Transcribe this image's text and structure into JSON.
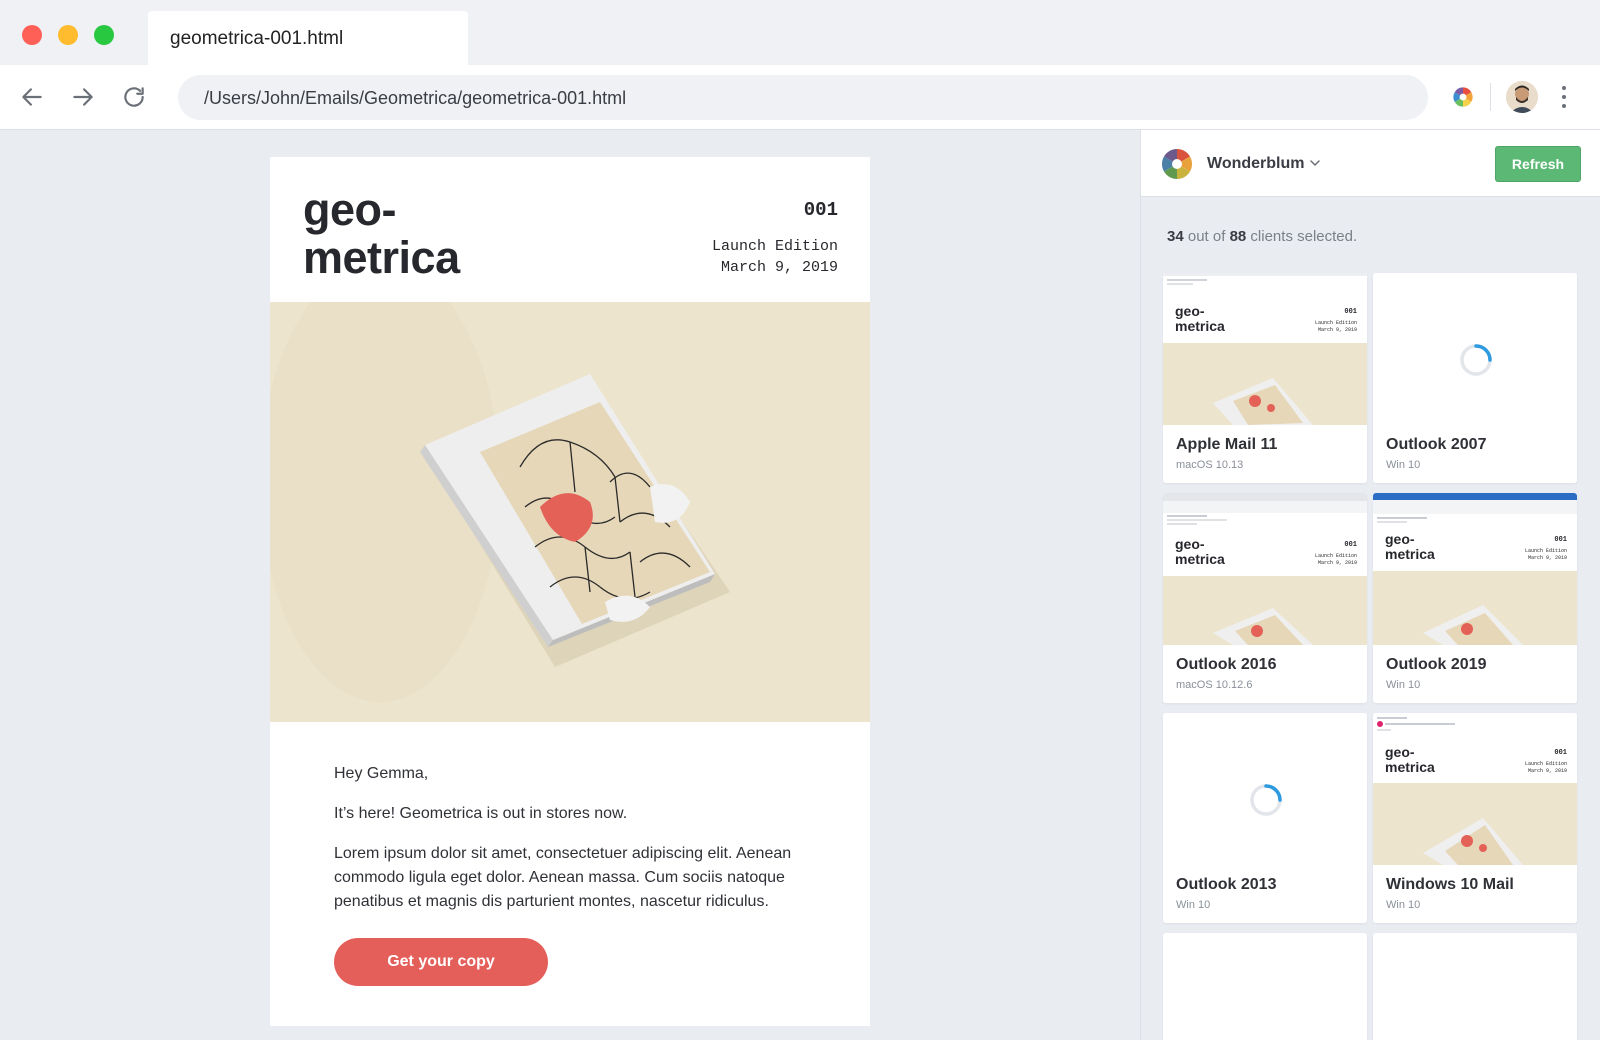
{
  "browser": {
    "tab_title": "geometrica-001.html",
    "address": "/Users/John/Emails/Geometrica/geometrica-001.html",
    "icons": [
      "back-arrow-icon",
      "forward-arrow-icon",
      "reload-icon",
      "extension-icon",
      "avatar",
      "more-vert-icon"
    ]
  },
  "email": {
    "brand_line1": "geo-",
    "brand_line2": "metrica",
    "issue": "001",
    "edition": "Launch Edition",
    "date": "March 9, 2019",
    "greeting": "Hey Gemma,",
    "intro": "It’s here! Geometrica is out in stores now.",
    "body": "Lorem ipsum dolor sit amet, consectetuer adipiscing elit. Aenean commodo ligula eget dolor. Aenean massa. Cum sociis natoque penatibus et magnis dis parturient montes, nascetur ridiculus.",
    "cta": "Get your copy",
    "colors": {
      "accent": "#e45f59",
      "hero_bg": "#ede4cd"
    }
  },
  "panel": {
    "workspace": "Wonderblum",
    "refresh": "Refresh",
    "selected_count": "34",
    "total_count": "88",
    "selected_text_mid": "out of",
    "selected_text_end": "clients selected.",
    "refresh_color": "#5cb875",
    "clients": [
      {
        "name": "Apple Mail 11",
        "os": "macOS 10.13",
        "status": "rendered"
      },
      {
        "name": "Outlook 2007",
        "os": "Win 10",
        "status": "loading"
      },
      {
        "name": "Outlook 2016",
        "os": "macOS 10.12.6",
        "status": "rendered"
      },
      {
        "name": "Outlook 2019",
        "os": "Win 10",
        "status": "rendered"
      },
      {
        "name": "Outlook 2013",
        "os": "Win 10",
        "status": "loading"
      },
      {
        "name": "Windows 10 Mail",
        "os": "Win 10",
        "status": "rendered"
      }
    ],
    "thumb": {
      "brand_line1": "geo-",
      "brand_line2": "metrica",
      "issue": "001",
      "edition": "Launch Edition",
      "date": "March 9, 2019"
    }
  }
}
